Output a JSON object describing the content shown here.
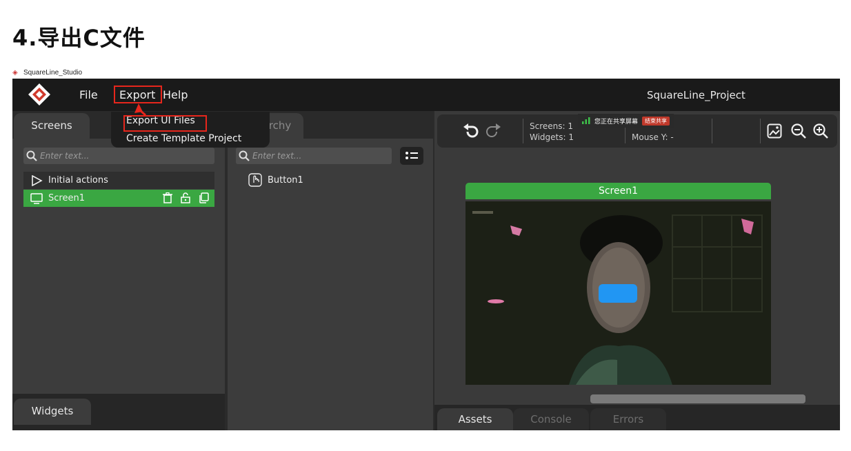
{
  "page": {
    "heading": "4.导出C文件"
  },
  "window": {
    "title": "SquareLine_Studio"
  },
  "menubar": {
    "file": "File",
    "export": "Export",
    "help": "Help",
    "project_title": "SquareLine_Project"
  },
  "export_menu": {
    "items": [
      "Export UI Files",
      "Create Template Project"
    ]
  },
  "screens_panel": {
    "tab": "Screens",
    "search_placeholder": "Enter text...",
    "rows": [
      "Initial actions",
      "Screen1"
    ]
  },
  "hierarchy_panel": {
    "tab": "Hierarchy",
    "search_placeholder": "Enter text...",
    "items": [
      "Button1"
    ]
  },
  "widgets_panel": {
    "tab": "Widgets"
  },
  "toolbar": {
    "screens_label": "Screens: 1",
    "widgets_label": "Widgets: 1",
    "mouse_y_label": "Mouse Y: -"
  },
  "share_banner": {
    "text": "您正在共享屏幕",
    "stop": "结束共享"
  },
  "canvas": {
    "screen_title": "Screen1"
  },
  "bottom_tabs": [
    "Assets",
    "Console",
    "Errors"
  ],
  "colors": {
    "accent_green": "#3aa742",
    "highlight_red": "#e8261c",
    "button_blue": "#2196f3"
  }
}
